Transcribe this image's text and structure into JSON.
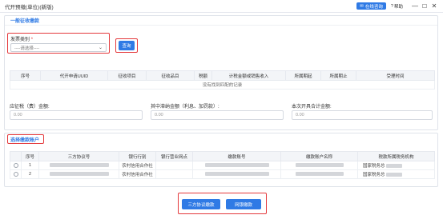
{
  "window": {
    "title": "代开预缴(单位)(新版)",
    "online_help": "在线咨询",
    "help": "帮助",
    "minimize": "—",
    "maximize": "☐",
    "close": "✕"
  },
  "section1": {
    "title": "一般征收缴款",
    "invoice_type_label": "发票类别",
    "invoice_type_required": "*",
    "invoice_type_value": "----请选择----",
    "query_button": "查询",
    "table": {
      "columns": [
        "序号",
        "代开申请UUID",
        "征收项目",
        "征收品目",
        "税额",
        "计税金额或销售收入",
        "所属期起",
        "所属期止",
        "受理时间"
      ],
      "empty_message": "没有找到匹配的记录"
    },
    "amounts": [
      {
        "label": "应征税（费）金额:",
        "value": "0.00"
      },
      {
        "label": "其中滞纳金额（利息、加罚款）:",
        "value": "0.00"
      },
      {
        "label": "本次开具合计金额:",
        "value": "0.00"
      }
    ]
  },
  "section2": {
    "title": "选择缴款账户",
    "table": {
      "columns": [
        "序号",
        "三方协议号",
        "银行行别",
        "银行营业网点",
        "缴款账号",
        "缴款账户名称",
        "税款所属税务机构"
      ],
      "rows": [
        {
          "index": "1",
          "bank_type": "农村信用合作社",
          "tax_org": "国家税务总"
        },
        {
          "index": "2",
          "bank_type": "农村信用合作社",
          "tax_org": "国家税务总"
        }
      ]
    }
  },
  "footer": {
    "tripartite_button": "三方协议缴款",
    "bank_card_button": "网银缴款"
  },
  "colors": {
    "accent": "#2f7ae5",
    "highlight": "#e4393c"
  }
}
